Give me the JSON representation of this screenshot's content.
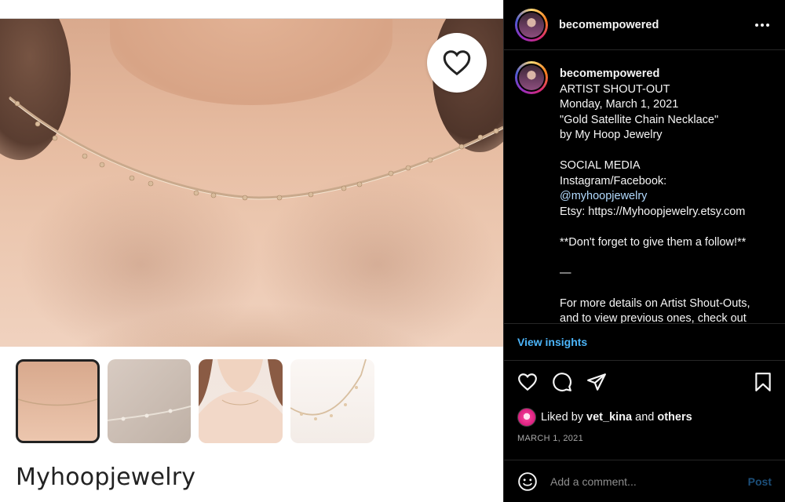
{
  "left": {
    "shop_name": "Myhoopjewelry"
  },
  "post": {
    "username": "becomempowered",
    "caption_lines": [
      "ARTIST SHOUT-OUT",
      "Monday, March 1, 2021",
      "\"Gold Satellite Chain Necklace\"",
      "by My Hoop Jewelry",
      "",
      "SOCIAL MEDIA",
      "Instagram/Facebook:",
      "@myhoopjewelry",
      "Etsy: https://Myhoopjewelry.etsy.com",
      "",
      "**Don't forget to give them a follow!**",
      "",
      "—",
      "",
      "For more details on Artist Shout-Outs,",
      "and to view previous ones, check out"
    ],
    "view_insights": "View insights",
    "liked_by_prefix": "Liked by ",
    "liked_by_user": "vet_kina",
    "liked_by_and": " and ",
    "liked_by_others": "others",
    "date": "MARCH 1, 2021",
    "comment_placeholder": "Add a comment...",
    "post_label": "Post"
  },
  "colors": {
    "link_blue": "#4cb5f9",
    "mention": "#b3dbff",
    "post_disabled": "#1c4f7a"
  },
  "icons": {
    "favorite": "heart-outline-icon",
    "more": "more-horizontal-icon",
    "like": "heart-icon",
    "comment": "comment-icon",
    "share": "paper-plane-icon",
    "save": "bookmark-icon",
    "emoji": "emoji-icon"
  }
}
